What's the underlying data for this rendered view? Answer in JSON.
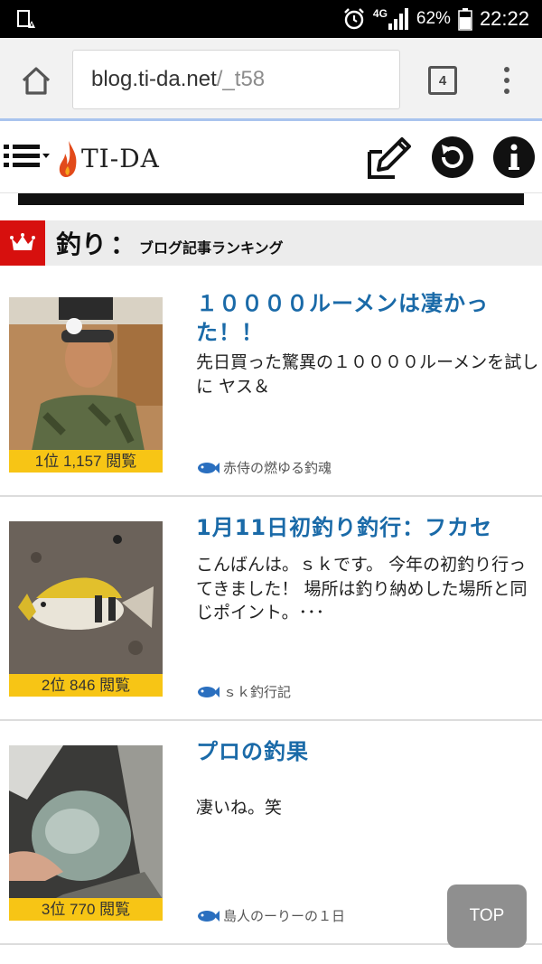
{
  "status_bar": {
    "network": "4G",
    "battery": "62%",
    "time": "22:22"
  },
  "browser": {
    "url_host": "blog.ti-da.net",
    "url_path": "/_t58",
    "tab_count": "4"
  },
  "site": {
    "logo_text": "TI-DA"
  },
  "section": {
    "title": "釣り",
    "colon": "：",
    "subtitle": "ブログ記事ランキング"
  },
  "rankings": [
    {
      "rank_label": "1位 1,157 閲覧",
      "title": "１００００ルーメンは凄かった！！",
      "description": "先日買った驚異の１００００ルーメンを試しに ヤス＆",
      "blog_name": "赤侍の燃ゆる釣魂"
    },
    {
      "rank_label": "2位 846 閲覧",
      "title": "1月11日初釣り釣行：フカセ",
      "description": "こんばんは。ｓｋです。 今年の初釣り行ってきました！ 場所は釣り納めした場所と同じポイント。･･･",
      "blog_name": "ｓｋ釣行記"
    },
    {
      "rank_label": "3位 770 閲覧",
      "title": "プロの釣果",
      "description": "凄いね。笑",
      "blog_name": "島人のーりーの１日"
    }
  ],
  "top_button": "TOP",
  "colors": {
    "accent_red": "#d7100e",
    "title_blue": "#1a6aa8",
    "badge_yellow": "#f7c515"
  }
}
